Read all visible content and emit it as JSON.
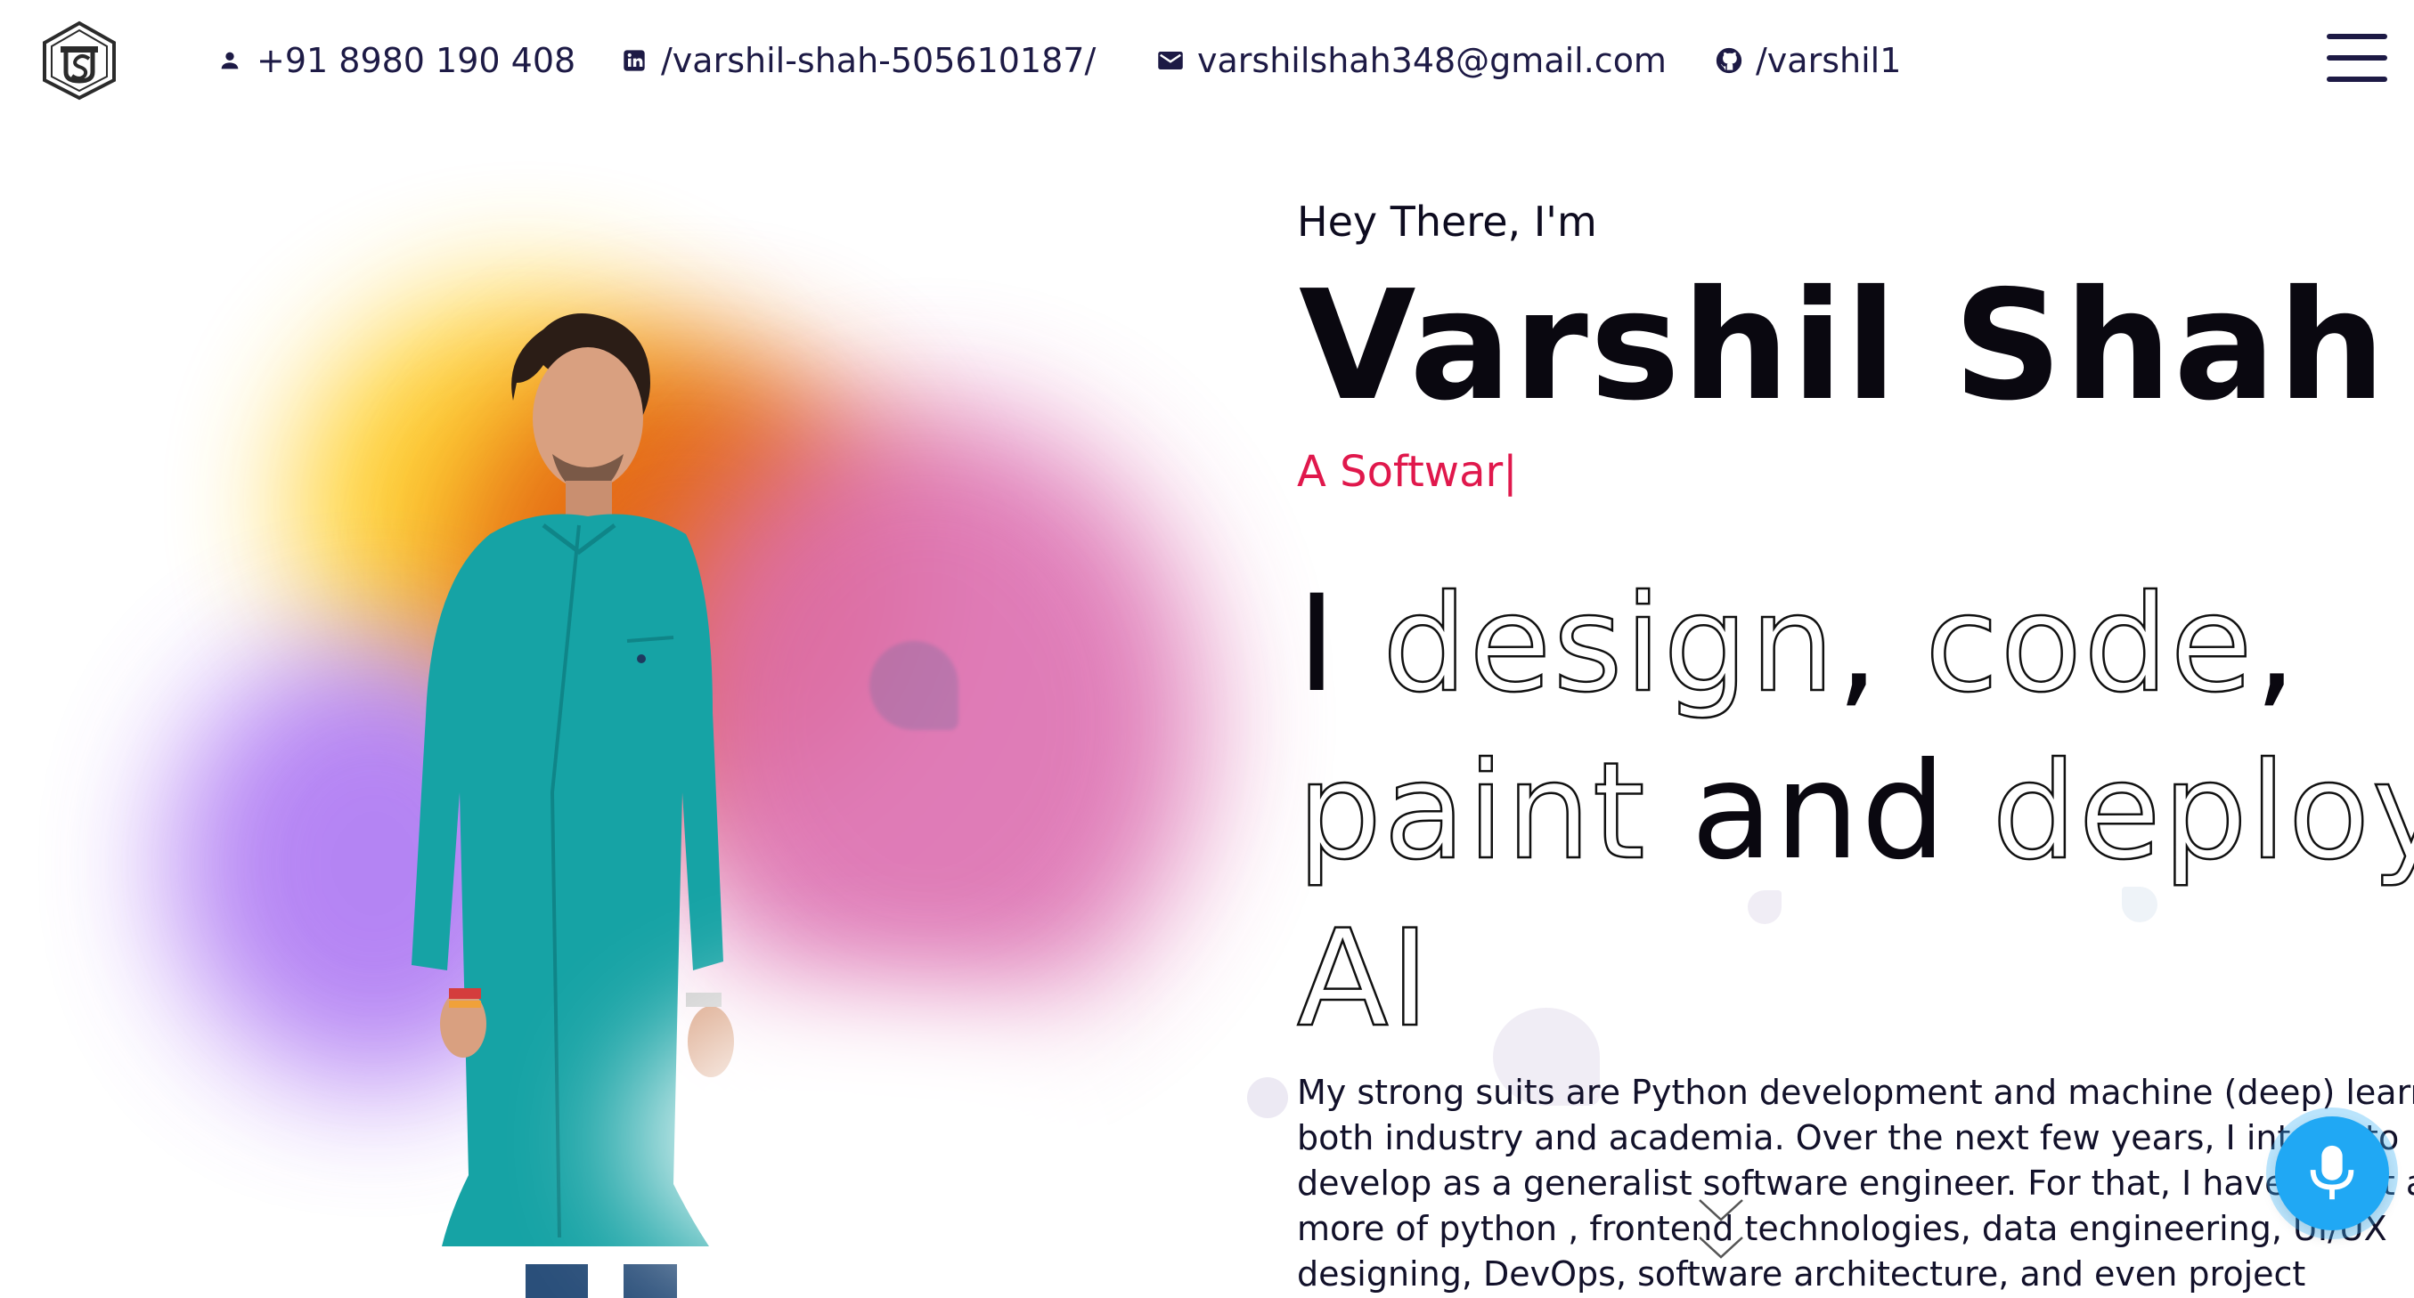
{
  "header": {
    "phone": "+91 8980 190 408",
    "linkedin": "/varshil-shah-505610187/",
    "email": "varshilshah348@gmail.com",
    "github": "/varshil1",
    "logo_icon": "vs-monogram-icon",
    "menu_icon": "hamburger-menu-icon"
  },
  "hero": {
    "intro": "Hey There, I'm",
    "name": "Varshil Shah",
    "typing_text": "A Softwar",
    "typing_cursor": "|",
    "tagline": {
      "w1": "I",
      "w2": "design",
      "w3": ",",
      "w4": "code",
      "w5": ",",
      "w6": "paint",
      "w7": "and",
      "w8": "deploy",
      "w9": "AI"
    },
    "bio_lines": [
      "My strong suits are Python development and machine (deep) learning in",
      "both industry and academia. Over the next few years, I intend to",
      "develop as a generalist software engineer. For that, I have learnt a bit",
      "more of python , frontend technologies, data engineering, UI/UX",
      "designing, DevOps, software architecture, and even project"
    ]
  },
  "colors": {
    "accent": "#e0184c",
    "mic": "#20a8f4",
    "text": "#12112a"
  },
  "mic_icon": "microphone-icon",
  "scroll_icon": "chevron-down-icon"
}
